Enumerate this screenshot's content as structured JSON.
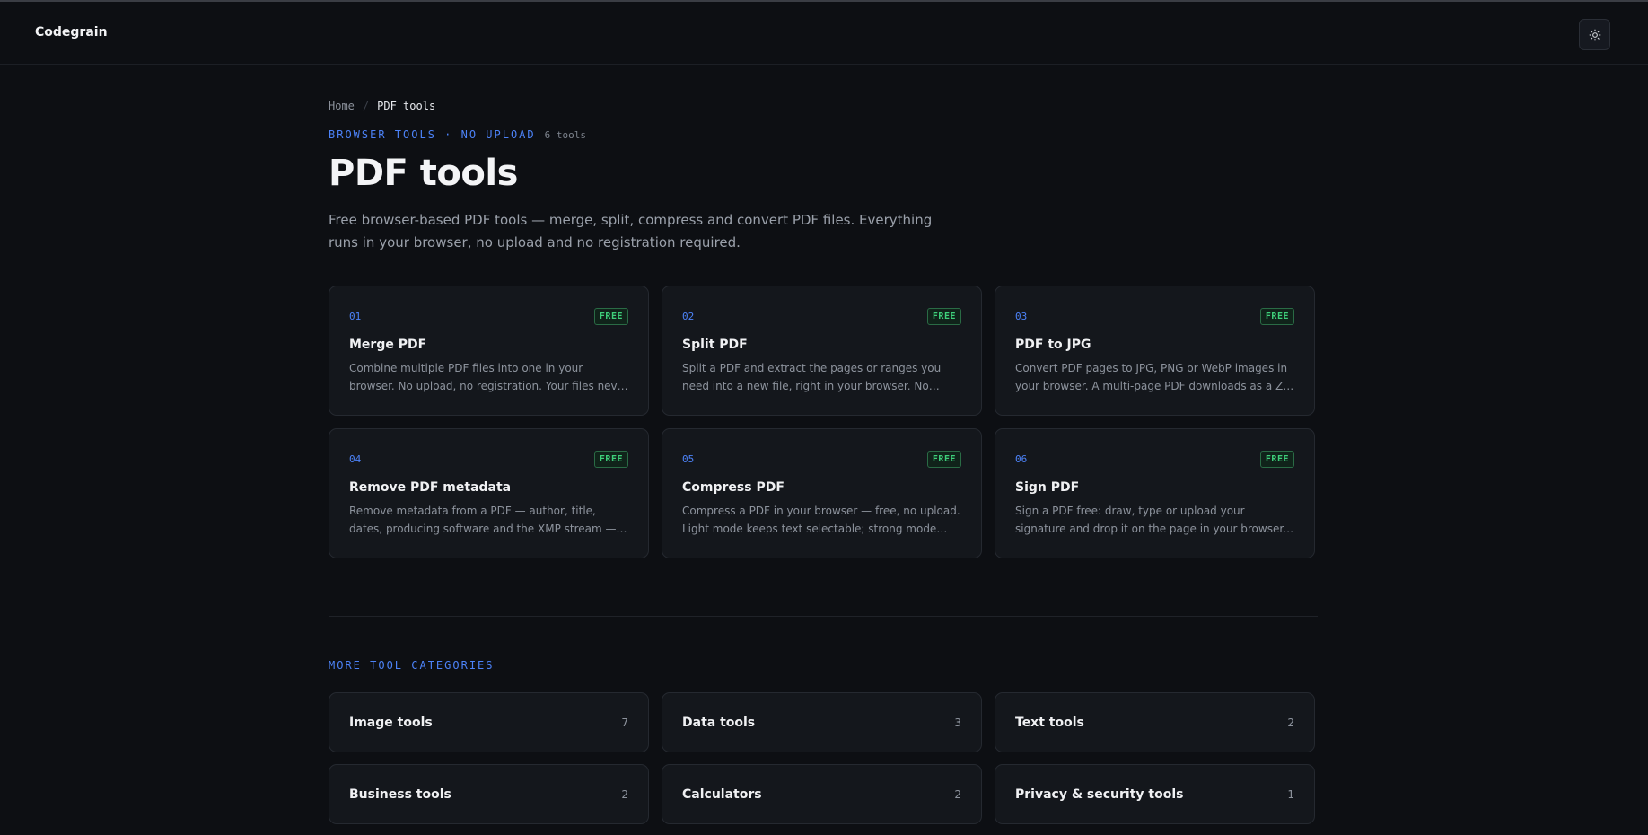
{
  "header": {
    "brand": "Codegrain",
    "theme_toggle_icon": "sun-icon"
  },
  "breadcrumb": {
    "home": "Home",
    "separator": "/",
    "current": "PDF tools"
  },
  "hero": {
    "eyebrow": "BROWSER TOOLS · NO UPLOAD",
    "tool_count": "6 tools",
    "title": "PDF tools",
    "description": "Free browser-based PDF tools — merge, split, compress and convert PDF files. Everything runs in your browser, no upload and no registration required."
  },
  "tools": [
    {
      "num": "01",
      "badge": "FREE",
      "name": "Merge PDF",
      "text": "Combine multiple PDF files into one in your browser. No upload, no registration. Your files never leave your device."
    },
    {
      "num": "02",
      "badge": "FREE",
      "name": "Split PDF",
      "text": "Split a PDF and extract the pages or ranges you need into a new file, right in your browser. No upload, no registration."
    },
    {
      "num": "03",
      "badge": "FREE",
      "name": "PDF to JPG",
      "text": "Convert PDF pages to JPG, PNG or WebP images in your browser. A multi-page PDF downloads as a ZIP archive."
    },
    {
      "num": "04",
      "badge": "FREE",
      "name": "Remove PDF metadata",
      "text": "Remove metadata from a PDF — author, title, dates, producing software and the XMP stream — free, in your browser."
    },
    {
      "num": "05",
      "badge": "FREE",
      "name": "Compress PDF",
      "text": "Compress a PDF in your browser — free, no upload. Light mode keeps text selectable; strong mode rasterizes pages."
    },
    {
      "num": "06",
      "badge": "FREE",
      "name": "Sign PDF",
      "text": "Sign a PDF free: draw, type or upload your signature and drop it on the page in your browser. No upload required."
    }
  ],
  "more": {
    "label": "MORE TOOL CATEGORIES",
    "categories": [
      {
        "name": "Image tools",
        "count": "7"
      },
      {
        "name": "Data tools",
        "count": "3"
      },
      {
        "name": "Text tools",
        "count": "2"
      },
      {
        "name": "Business tools",
        "count": "2"
      },
      {
        "name": "Calculators",
        "count": "2"
      },
      {
        "name": "Privacy & security tools",
        "count": "1"
      }
    ]
  },
  "colors": {
    "accent": "#4c82f7",
    "free_badge": "#3ecf7a",
    "background": "#0d0f13"
  }
}
